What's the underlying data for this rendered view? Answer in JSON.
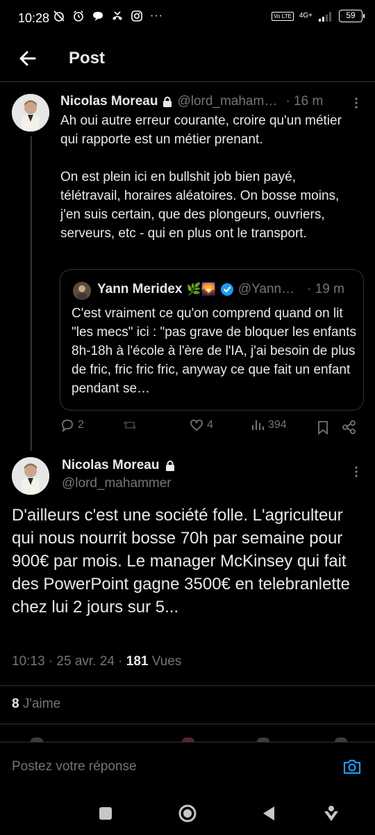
{
  "status_bar": {
    "time": "10:28",
    "battery": "59",
    "network": "4G+",
    "volte": "Vo LTE"
  },
  "header": {
    "title": "Post"
  },
  "tweet1": {
    "name": "Nicolas Moreau",
    "handle": "@lord_mahammer",
    "time": "· 16 m",
    "body": "Ah oui autre erreur courante, croire qu'un métier qui rapporte est un métier prenant.\n\nOn est plein ici en bullshit job bien payé, télétravail, horaires aléatoires. On bosse moins, j'en suis certain, que des plongeurs, ouvriers, serveurs, etc - qui en plus ont le transport.",
    "quote": {
      "name": "Yann Meridex",
      "emoji": "🌿🌄",
      "handle": "@Yann…",
      "time": "· 19 m",
      "body": "C'est vraiment ce qu'on comprend quand on lit \"les mecs\" ici : \"pas grave de bloquer les enfants 8h-18h à l'école à l'ère de l'IA, j'ai besoin de plus de fric, fric fric fric, anyway ce que fait un enfant pendant se…"
    },
    "actions": {
      "replies": "2",
      "reposts": "",
      "likes": "4",
      "views": "394"
    }
  },
  "tweet2": {
    "name": "Nicolas Moreau",
    "handle": "@lord_mahammer",
    "body": "D'ailleurs c'est une société folle. L'agriculteur qui nous nourrit bosse 70h par semaine pour 900€ par mois. Le manager McKinsey qui fait des PowerPoint gagne 3500€ en telebranlette chez lui 2 jours sur 5...",
    "meta_time": "10:13 · 25 avr. 24 · ",
    "views_count": "181",
    "views_label": " Vues",
    "likes_count": "8",
    "likes_label": " J'aime"
  },
  "reply": {
    "placeholder": "Postez votre réponse"
  },
  "colors": {
    "background": "#000000",
    "text": "#e7e9ea",
    "muted": "#71767b",
    "border": "#2f3336",
    "accent": "#1d9bf0"
  }
}
